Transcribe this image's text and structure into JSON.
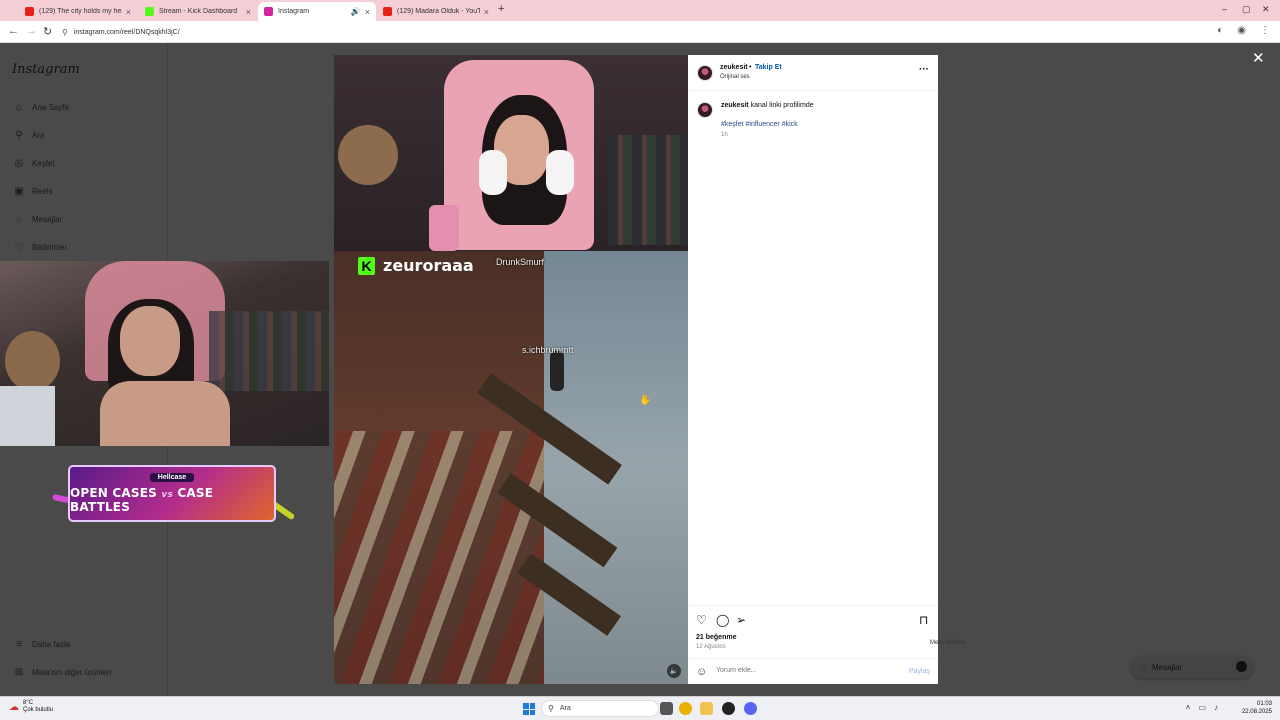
{
  "browser": {
    "tabs": [
      {
        "title": "(129) The city holds my heart",
        "favicon": "youtube-icon",
        "color": "#e62117",
        "active": false
      },
      {
        "title": "Stream - Kick Dashboard",
        "favicon": "kick-icon",
        "color": "#53fc18",
        "active": false
      },
      {
        "title": "Instagram",
        "favicon": "instagram-icon",
        "color": "#d6249f",
        "active": true
      },
      {
        "title": "(129) Madara Olduk - YouTube",
        "favicon": "youtube-icon",
        "color": "#e62117",
        "active": false
      }
    ],
    "url": "instagram.com/reel/DNQsqkhl3jC/"
  },
  "instagram": {
    "logo": "Instagram",
    "nav": [
      {
        "label": "Ana Sayfa",
        "icon": "home-icon"
      },
      {
        "label": "Ara",
        "icon": "search-icon"
      },
      {
        "label": "Keşfet",
        "icon": "compass-icon"
      },
      {
        "label": "Reels",
        "icon": "reels-icon"
      },
      {
        "label": "Mesajlar",
        "icon": "messenger-icon"
      },
      {
        "label": "Bildirimler",
        "icon": "heart-icon"
      }
    ],
    "bottom_nav": [
      {
        "label": "Daha fazla",
        "icon": "menu-icon"
      },
      {
        "label": "Meta'nın diğer ürünleri",
        "icon": "meta-icon"
      }
    ],
    "footer_links": "Meta Verified",
    "messages_pill": "Mesajlar"
  },
  "overlay": {
    "promo_brand": "Hellcase",
    "promo_left": "OPEN CASES",
    "promo_vs": "vs",
    "promo_right": "CASE BATTLES"
  },
  "reel": {
    "kick_letter": "K",
    "streamer": "zeuroraaa",
    "game_tag_1": "DrunkSmurf",
    "game_tag_2": "s.ichbrummtt"
  },
  "post": {
    "username": "zeukesit",
    "separator": "•",
    "follow": "Takip Et",
    "audio": "Orijinal ses",
    "caption_user": "zeukesit",
    "caption_text": "kanal linki profilimde",
    "hashtags": "#keşfet #influencer #kick",
    "age": "1h",
    "likes": "21 beğenme",
    "date": "12 Ağustos",
    "comment_placeholder": "Yorum ekle...",
    "share": "Paylaş"
  },
  "taskbar": {
    "temp": "8°C",
    "weather": "Çok bulutlu",
    "search": "Ara",
    "time": "01:03",
    "date": "22.08.2025"
  }
}
